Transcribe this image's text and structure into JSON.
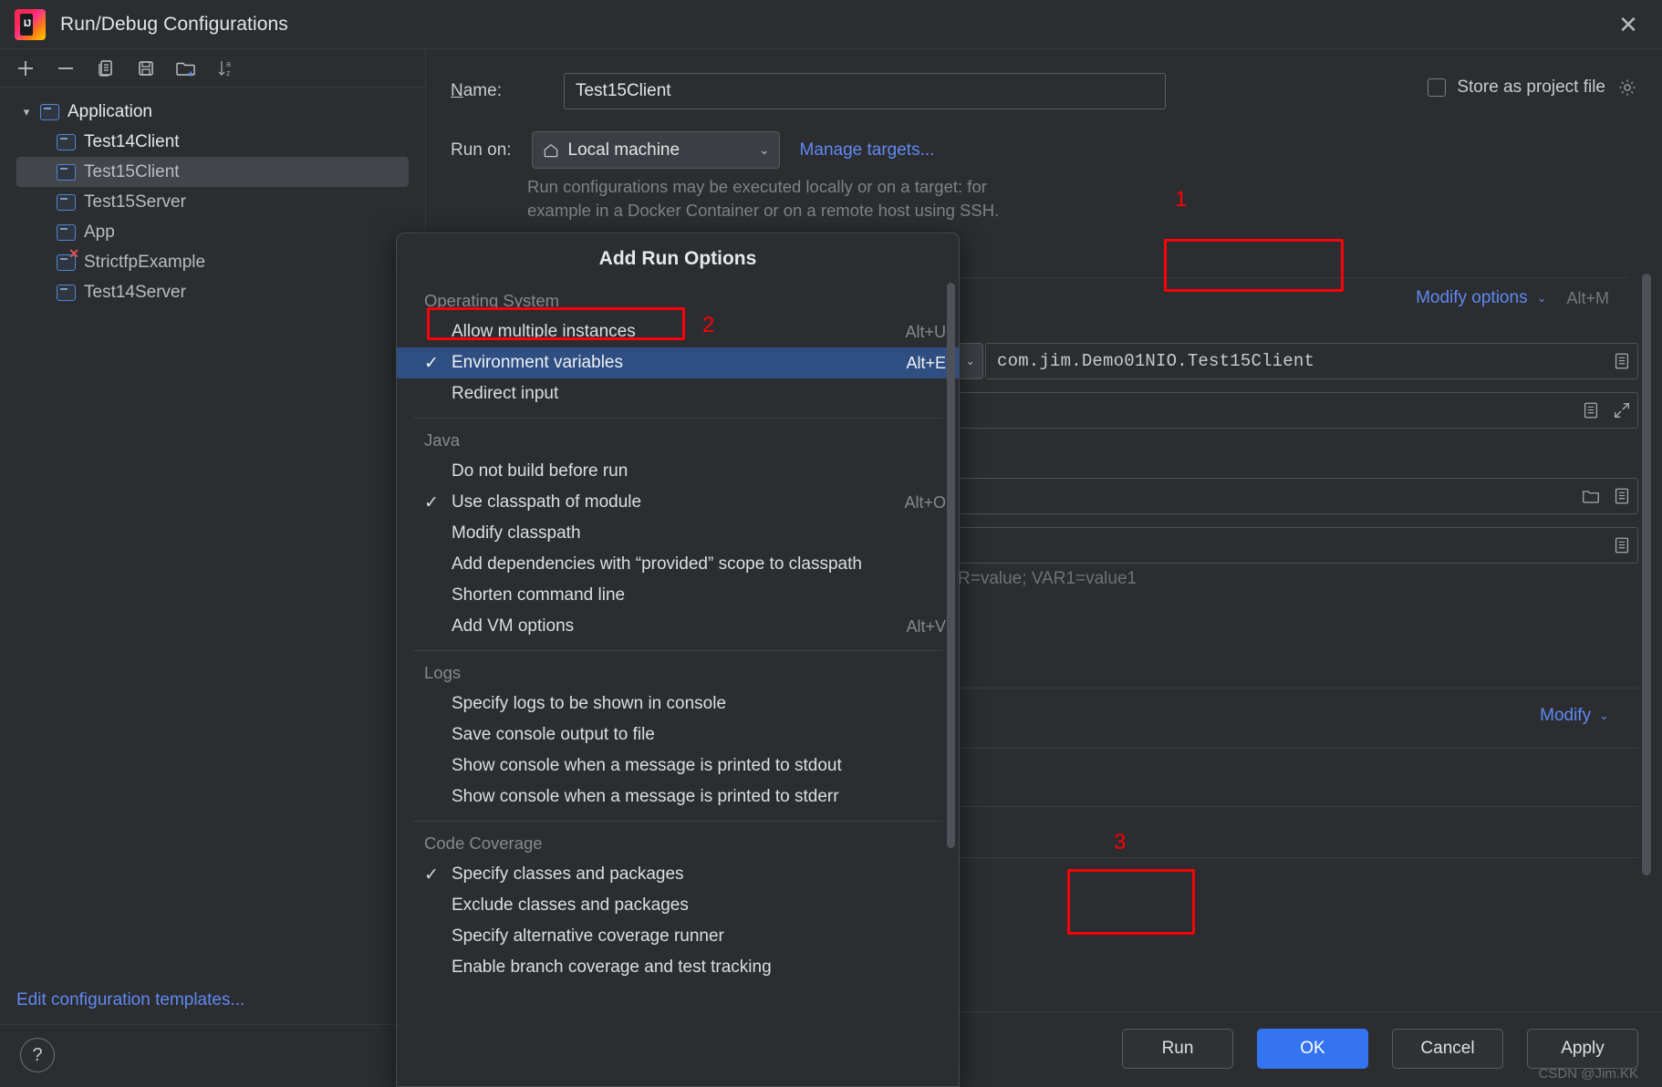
{
  "window": {
    "title": "Run/Debug Configurations",
    "logo_text": "IJ",
    "close_icon": "close-icon"
  },
  "left_panel": {
    "toolbar": [
      {
        "name": "add-configuration-button",
        "icon": "plus-icon"
      },
      {
        "name": "remove-configuration-button",
        "icon": "minus-icon"
      },
      {
        "name": "copy-configuration-button",
        "icon": "copy-icon"
      },
      {
        "name": "save-configuration-button",
        "icon": "save-icon"
      },
      {
        "name": "new-folder-button",
        "icon": "folder-add-icon"
      },
      {
        "name": "sort-configurations-button",
        "icon": "sort-alpha-icon"
      }
    ],
    "tree": [
      {
        "label": "Application",
        "level": 0,
        "expanded": true,
        "selected": false,
        "error": false
      },
      {
        "label": "Test14Client",
        "level": 1,
        "selected": false,
        "error": false,
        "bright": true
      },
      {
        "label": "Test15Client",
        "level": 1,
        "selected": true,
        "error": false
      },
      {
        "label": "Test15Server",
        "level": 1,
        "selected": false,
        "error": false
      },
      {
        "label": "App",
        "level": 1,
        "selected": false,
        "error": false
      },
      {
        "label": "StrictfpExample",
        "level": 1,
        "selected": false,
        "error": true
      },
      {
        "label": "Test14Server",
        "level": 1,
        "selected": false,
        "error": false
      }
    ],
    "edit_templates_link": "Edit configuration templates...",
    "help_label": "?"
  },
  "form": {
    "name_label": "Name:",
    "name_label_mnemonic": "N",
    "name_value": "Test15Client",
    "store_as_project_file_label": "Store as project file",
    "store_as_project_file_checked": false,
    "store_gear_icon": "gear-icon",
    "run_on_label": "Run on:",
    "run_on_value": "Local machine",
    "run_on_icon": "home-icon",
    "manage_targets_link": "Manage targets...",
    "hint_line1": "Run configurations may be executed locally or on a target: for",
    "hint_line2": "example in a Docker Container or on a remote host using SSH.",
    "modify_options_link": "Modify options",
    "modify_options_shortcut": "Alt+M",
    "main_class_value": "com.jim.Demo01NIO.Test15Client",
    "env_vars_placeholder": "R=value; VAR1=value1",
    "modify_link": "Modify"
  },
  "popup": {
    "title": "Add Run Options",
    "groups": [
      {
        "label": "Operating System",
        "items": [
          {
            "label": "Allow multiple instances",
            "checked": false,
            "shortcut": "Alt+U",
            "selected": false,
            "highlighted": true
          },
          {
            "label": "Environment variables",
            "checked": true,
            "shortcut": "Alt+E",
            "selected": true,
            "highlighted": false
          },
          {
            "label": "Redirect input",
            "checked": false,
            "shortcut": "",
            "selected": false,
            "highlighted": false
          }
        ]
      },
      {
        "label": "Java",
        "items": [
          {
            "label": "Do not build before run",
            "checked": false,
            "shortcut": "",
            "selected": false,
            "highlighted": false
          },
          {
            "label": "Use classpath of module",
            "checked": true,
            "shortcut": "Alt+O",
            "selected": false,
            "highlighted": false
          },
          {
            "label": "Modify classpath",
            "checked": false,
            "shortcut": "",
            "selected": false,
            "highlighted": false
          },
          {
            "label": "Add dependencies with “provided” scope to classpath",
            "checked": false,
            "shortcut": "",
            "selected": false,
            "highlighted": false
          },
          {
            "label": "Shorten command line",
            "checked": false,
            "shortcut": "",
            "selected": false,
            "highlighted": false
          },
          {
            "label": "Add VM options",
            "checked": false,
            "shortcut": "Alt+V",
            "selected": false,
            "highlighted": false
          }
        ]
      },
      {
        "label": "Logs",
        "items": [
          {
            "label": "Specify logs to be shown in console",
            "checked": false,
            "shortcut": "",
            "selected": false,
            "highlighted": false
          },
          {
            "label": "Save console output to file",
            "checked": false,
            "shortcut": "",
            "selected": false,
            "highlighted": false
          },
          {
            "label": "Show console when a message is printed to stdout",
            "checked": false,
            "shortcut": "",
            "selected": false,
            "highlighted": false
          },
          {
            "label": "Show console when a message is printed to stderr",
            "checked": false,
            "shortcut": "",
            "selected": false,
            "highlighted": false
          }
        ]
      },
      {
        "label": "Code Coverage",
        "items": [
          {
            "label": "Specify classes and packages",
            "checked": true,
            "shortcut": "",
            "selected": false,
            "highlighted": false
          },
          {
            "label": "Exclude classes and packages",
            "checked": false,
            "shortcut": "",
            "selected": false,
            "highlighted": false
          },
          {
            "label": "Specify alternative coverage runner",
            "checked": false,
            "shortcut": "",
            "selected": false,
            "highlighted": false
          },
          {
            "label": "Enable branch coverage and test tracking",
            "checked": false,
            "shortcut": "",
            "selected": false,
            "highlighted": false
          }
        ]
      }
    ]
  },
  "buttons": {
    "run": "Run",
    "ok": "OK",
    "cancel": "Cancel",
    "apply": "Apply"
  },
  "annotations": [
    {
      "number": "1"
    },
    {
      "number": "2"
    },
    {
      "number": "3"
    }
  ],
  "watermark": "CSDN @Jim.KK",
  "colors": {
    "accent_blue": "#3574f0",
    "link_blue": "#5f89f2",
    "annotation_red": "#fb0007",
    "selection_blue": "#2f4f82",
    "background": "#2b2d30"
  }
}
